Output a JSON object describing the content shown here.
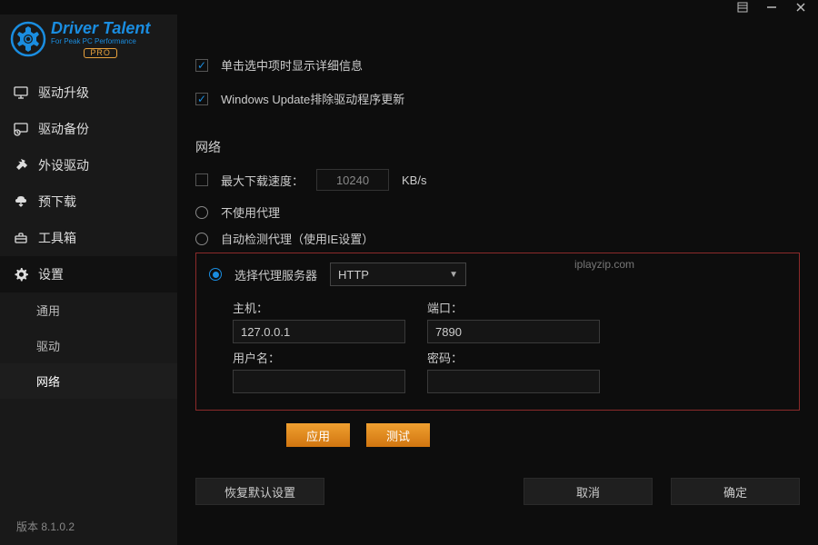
{
  "titlebar": {
    "menu": "☰"
  },
  "logo": {
    "brand": "Driver Talent",
    "sub": "For Peak PC Performance",
    "pro": "PRO"
  },
  "sidebar": {
    "items": [
      {
        "label": "驱动升级"
      },
      {
        "label": "驱动备份"
      },
      {
        "label": "外设驱动"
      },
      {
        "label": "预下载"
      },
      {
        "label": "工具箱"
      },
      {
        "label": "设置"
      }
    ],
    "sub": [
      {
        "label": "通用"
      },
      {
        "label": "驱动"
      },
      {
        "label": "网络"
      }
    ]
  },
  "settings": {
    "check1": "单击选中项时显示详细信息",
    "check2": "Windows Update排除驱动程序更新",
    "network_title": "网络",
    "max_speed_label": "最大下载速度：",
    "max_speed_value": "10240",
    "max_speed_unit": "KB/s",
    "proxy_none": "不使用代理",
    "proxy_auto": "自动检测代理（使用IE设置）",
    "proxy_select": "选择代理服务器",
    "proxy_type": "HTTP",
    "host_label": "主机：",
    "host_value": "127.0.0.1",
    "port_label": "端口：",
    "port_value": "7890",
    "user_label": "用户名：",
    "user_value": "",
    "pass_label": "密码：",
    "pass_value": "",
    "apply": "应用",
    "test": "测试",
    "restore": "恢复默认设置",
    "cancel": "取消",
    "ok": "确定"
  },
  "watermark": "iplayzip.com",
  "version": "版本 8.1.0.2"
}
